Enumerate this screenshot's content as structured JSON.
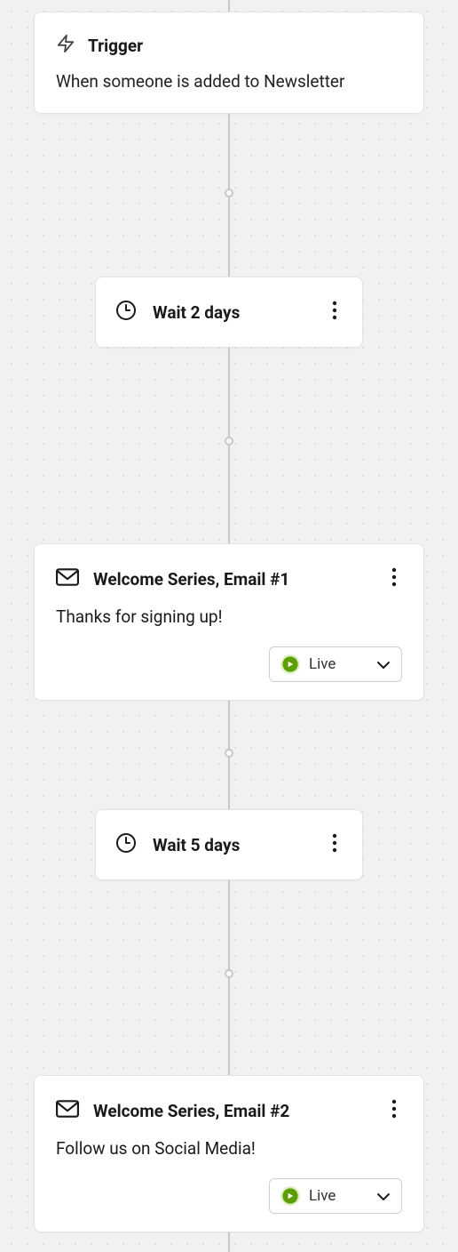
{
  "trigger": {
    "label": "Trigger",
    "description": "When someone is added to Newsletter"
  },
  "wait1": {
    "label": "Wait 2 days"
  },
  "email1": {
    "title": "Welcome Series, Email #1",
    "description": "Thanks for signing up!",
    "status": "Live"
  },
  "wait2": {
    "label": "Wait 5 days"
  },
  "email2": {
    "title": "Welcome Series, Email #2",
    "description": "Follow us on Social Media!",
    "status": "Live"
  }
}
